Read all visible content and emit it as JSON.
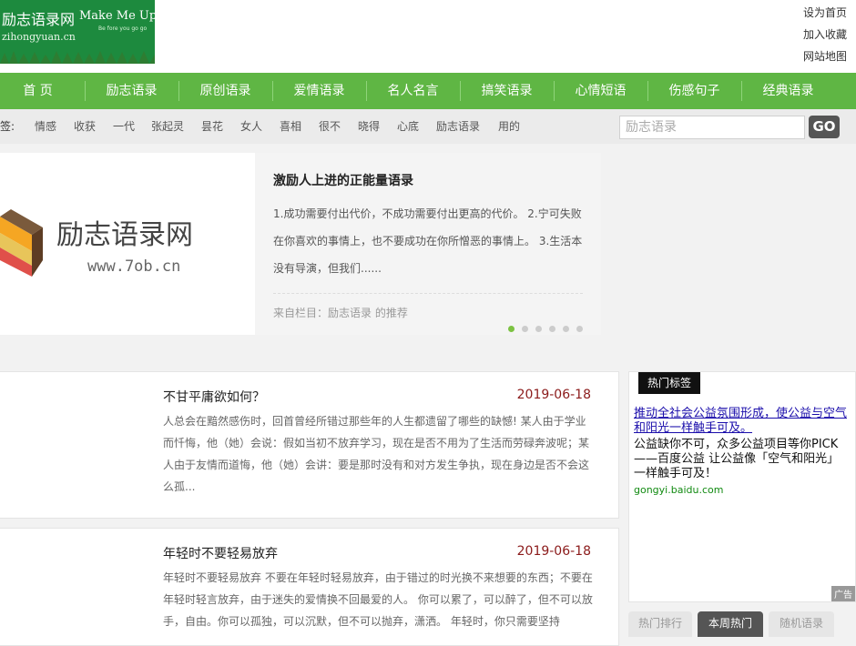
{
  "header": {
    "logo": {
      "brand_cn": "励志语录网",
      "brand_en": "Make Me Up!",
      "slogan": "Be fore you go go",
      "url": "zihongyuan.cn"
    },
    "links": [
      "设为首页",
      "加入收藏",
      "网站地图"
    ]
  },
  "nav": {
    "items": [
      "首 页",
      "励志语录",
      "原创语录",
      "爱情语录",
      "名人名言",
      "搞笑语录",
      "心情短语",
      "伤感句子",
      "经典语录"
    ]
  },
  "tagbar": {
    "label": "标签:",
    "tags": [
      "情感",
      "收获",
      "一代",
      "张起灵",
      "昙花",
      "女人",
      "喜相",
      "很不",
      "晓得",
      "心底",
      "励志语录",
      "用的"
    ],
    "search_placeholder": "励志语录",
    "search_button": "GO"
  },
  "slider": {
    "image_text_cn": "励志语录网",
    "image_text_url": "www.7ob.cn",
    "title": "激励人上进的正能量语录",
    "excerpt": "1.成功需要付出代价，不成功需要付出更高的代价。 2.宁可失败在你喜欢的事情上，也不要成功在你所憎恶的事情上。 3.生活本没有导演，但我们......",
    "source": "来自栏目：励志语录 的推荐",
    "slide_count": 6,
    "active_slide": 1
  },
  "articles": [
    {
      "title": "不甘平庸欲如何？",
      "date": "2019-06-18",
      "excerpt": "人总会在黯然感伤时，回首曾经所错过那些年的人生都遗留了哪些的缺憾! 某人由于学业而忏悔，他（她）会说：假如当初不放弃学习，现在是否不用为了生活而劳碌奔波呢；某人由于友情而道悔，他（她）会讲：要是那时没有和对方发生争执，现在身边是否不会这么孤..."
    },
    {
      "title": "年轻时不要轻易放弃",
      "date": "2019-06-18",
      "excerpt": "年轻时不要轻易放弃 不要在年轻时轻易放弃，由于错过的时光换不来想要的东西；不要在年轻时轻言放弃，由于迷失的爱情换不回最爱的人。 你可以累了，可以醉了，但不可以放手，自由。你可以孤独，可以沉默，但不可以抛弃，潇洒。 年轻时，你只需要坚持"
    }
  ],
  "sidebar": {
    "tab": "热门标签",
    "ad": {
      "title": "推动全社会公益氛围形成，使公益与空气和阳光一样触手可及。",
      "desc": "公益缺你不可，众多公益项目等你PICK——百度公益 让公益像「空气和阳光」一样触手可及！",
      "url": "gongyi.baidu.com",
      "tag": "广告"
    }
  },
  "bottom_tabs": [
    {
      "label": "热门排行",
      "active": false
    },
    {
      "label": "本周热门",
      "active": true
    },
    {
      "label": "随机语录",
      "active": false
    }
  ],
  "colors": {
    "nav_green": "#5fb644",
    "date_red": "#8b1a1a",
    "dot_active": "#7cc242"
  }
}
